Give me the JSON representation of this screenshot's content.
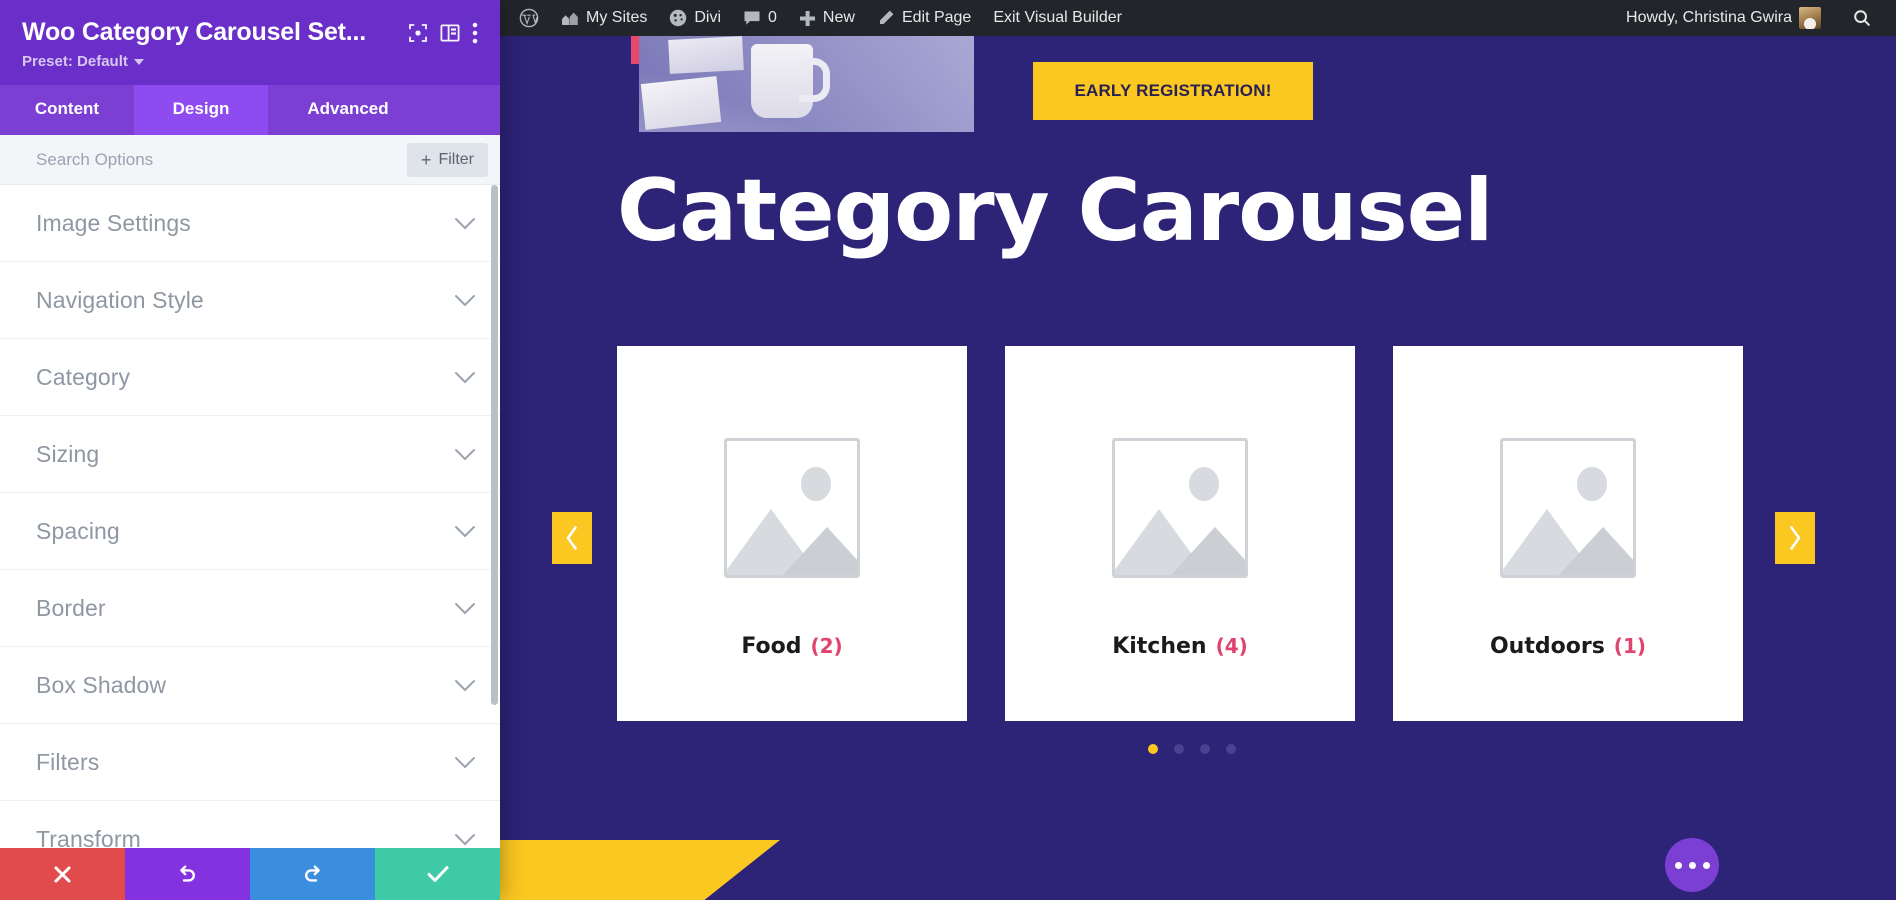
{
  "panel": {
    "title": "Woo Category Carousel Set...",
    "preset_label": "Preset: Default",
    "header_icons": [
      {
        "name": "focus-target-icon"
      },
      {
        "name": "layout-columns-icon"
      },
      {
        "name": "more-vertical-icon"
      }
    ],
    "tabs": [
      {
        "id": "content",
        "label": "Content",
        "active": false
      },
      {
        "id": "design",
        "label": "Design",
        "active": true
      },
      {
        "id": "advanced",
        "label": "Advanced",
        "active": false
      }
    ],
    "search": {
      "value": "",
      "placeholder": "Search Options"
    },
    "filter_button": {
      "label": "Filter",
      "plus": "+"
    },
    "sections": [
      {
        "label": "Image Settings",
        "expanded": false
      },
      {
        "label": "Navigation Style",
        "expanded": false
      },
      {
        "label": "Category",
        "expanded": false
      },
      {
        "label": "Sizing",
        "expanded": false
      },
      {
        "label": "Spacing",
        "expanded": false
      },
      {
        "label": "Border",
        "expanded": false
      },
      {
        "label": "Box Shadow",
        "expanded": false
      },
      {
        "label": "Filters",
        "expanded": false
      },
      {
        "label": "Transform",
        "expanded": false
      }
    ],
    "footer_buttons": [
      {
        "name": "discard-button",
        "icon": "close-x-icon",
        "color": "#e24b4b"
      },
      {
        "name": "undo-button",
        "icon": "undo-icon",
        "color": "#8431e0"
      },
      {
        "name": "redo-button",
        "icon": "redo-icon",
        "color": "#3b8ede"
      },
      {
        "name": "save-button",
        "icon": "checkmark-icon",
        "color": "#3ec9a7"
      }
    ]
  },
  "adminbar": {
    "left_items": [
      {
        "id": "wp-logo",
        "icon": "wordpress-logo-icon",
        "label": ""
      },
      {
        "id": "my-sites",
        "icon": "sites-icon",
        "label": "My Sites"
      },
      {
        "id": "divi",
        "icon": "divi-icon",
        "label": "Divi"
      },
      {
        "id": "comments",
        "icon": "comment-bubble-icon",
        "label": "0"
      },
      {
        "id": "new",
        "icon": "plus-icon",
        "label": "New"
      },
      {
        "id": "edit-page",
        "icon": "pencil-icon",
        "label": "Edit Page"
      },
      {
        "id": "exit-vb",
        "icon": "",
        "label": "Exit Visual Builder"
      }
    ],
    "greeting": "Howdy, Christina Gwira",
    "search_icon": "search-icon"
  },
  "page": {
    "cta_label": "EARLY REGISTRATION!",
    "headline": "Category Carousel",
    "carousel": {
      "prev_icon": "chevron-left-icon",
      "next_icon": "chevron-right-icon",
      "cards": [
        {
          "name": "Food",
          "count": "(2)"
        },
        {
          "name": "Kitchen",
          "count": "(4)"
        },
        {
          "name": "Outdoors",
          "count": "(1)"
        }
      ],
      "dots": [
        {
          "active": true
        },
        {
          "active": false
        },
        {
          "active": false
        },
        {
          "active": false
        }
      ]
    },
    "fab": {
      "name": "divi-menu-fab",
      "icon": "three-dots-icon"
    }
  },
  "colors": {
    "panel_header": "#6b2fc9",
    "panel_tabs": "#7b3fd4",
    "panel_tab_active": "#8e4bf0",
    "canvas_bg": "#2d2377",
    "accent_yellow": "#fbc721",
    "accent_pink": "#e0446e",
    "adminbar_bg": "#22262a"
  }
}
